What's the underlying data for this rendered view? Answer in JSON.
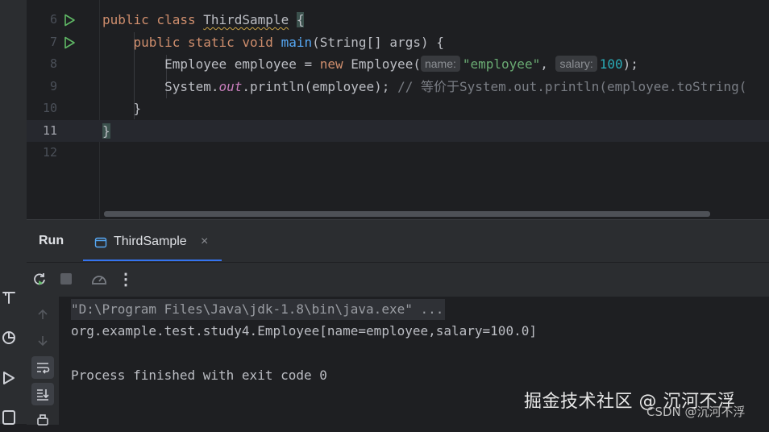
{
  "editor": {
    "lines": [
      {
        "num": "6"
      },
      {
        "num": "7"
      },
      {
        "num": "8"
      },
      {
        "num": "9"
      },
      {
        "num": "10"
      },
      {
        "num": "11"
      },
      {
        "num": "12"
      }
    ],
    "code": {
      "l6_kw": "public class ",
      "l6_name": "ThirdSample",
      "l6_brace": "{",
      "l7_indent": "    ",
      "l7_kw": "public static void ",
      "l7_fn": "main",
      "l7_rest": "(String[] args) {",
      "l8_indent": "        ",
      "l8_a": "Employee employee = ",
      "l8_new": "new",
      "l8_b": " Employee(",
      "l8_hint1": "name:",
      "l8_str": "\"employee\"",
      "l8_comma": ", ",
      "l8_hint2": "salary:",
      "l8_num": "100",
      "l8_end": ");",
      "l9_indent": "        ",
      "l9_a": "System.",
      "l9_out": "out",
      "l9_b": ".println(employee); ",
      "l9_cmt": "// 等价于System.out.println(employee.toString(",
      "l10_indent": "    ",
      "l10_brace": "}",
      "l11_brace": "}"
    }
  },
  "run_panel": {
    "title": "Run",
    "tab_label": "ThirdSample",
    "tab_close": "×",
    "more_options": "⋮"
  },
  "console": {
    "command": "\"D:\\Program Files\\Java\\jdk-1.8\\bin\\java.exe\" ...",
    "output": "org.example.test.study4.Employee[name=employee,salary=100.0]",
    "exit": "Process finished with exit code 0"
  },
  "watermark": {
    "main": "掘金技术社区 @ 沉河不浮",
    "sub": "CSDN @沉河不浮"
  },
  "colors": {
    "keyword": "#cf8e6d",
    "function": "#56a8f5",
    "string": "#6aab73",
    "number": "#2aacb8",
    "comment": "#7a7e85",
    "run_green": "#5fb865",
    "accent": "#3574f0"
  }
}
